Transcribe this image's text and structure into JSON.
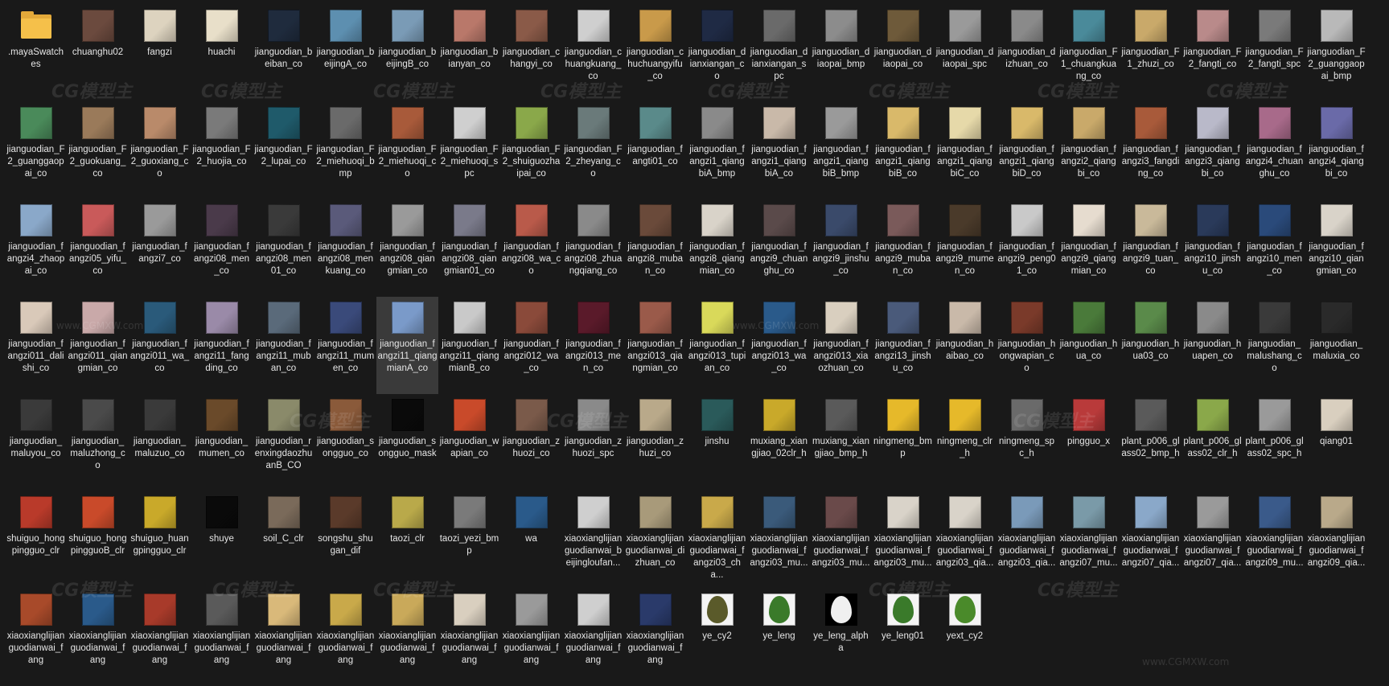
{
  "files": [
    {
      "name": ".mayaSwatches",
      "type": "folder"
    },
    {
      "name": "chuanghu02",
      "color": "#6b4a3e"
    },
    {
      "name": "fangzi",
      "color": "#ddd3bf"
    },
    {
      "name": "huachi",
      "color": "#e8dfc9"
    },
    {
      "name": "jianguodian_beiban_co",
      "color": "#1f2b3d"
    },
    {
      "name": "jianguodian_beijingA_co",
      "color": "#5d8fb0"
    },
    {
      "name": "jianguodian_beijingB_co",
      "color": "#7a9bb6"
    },
    {
      "name": "jianguodian_bianyan_co",
      "color": "#b9786a"
    },
    {
      "name": "jianguodian_changyi_co",
      "color": "#8a5a48"
    },
    {
      "name": "jianguodian_chuangkuang_co",
      "color": "#cfcfcf"
    },
    {
      "name": "jianguodian_chuchuangyifu_co",
      "color": "#c99a4a"
    },
    {
      "name": "jianguodian_dianxiangan_co",
      "color": "#1f2a44"
    },
    {
      "name": "jianguodian_dianxiangan_spc",
      "color": "#6a6a6a"
    },
    {
      "name": "jianguodian_diaopai_bmp",
      "color": "#8c8c8c"
    },
    {
      "name": "jianguodian_diaopai_co",
      "color": "#6e5a3a"
    },
    {
      "name": "jianguodian_diaopai_spc",
      "color": "#9a9a9a"
    },
    {
      "name": "jianguodian_dizhuan_co",
      "color": "#8a8a8a"
    },
    {
      "name": "jianguodian_F1_chuangkuang_co",
      "color": "#4a8a9a"
    },
    {
      "name": "jianguodian_F1_zhuzi_co",
      "color": "#c9a96a"
    },
    {
      "name": "jianguodian_F2_fangti_co",
      "color": "#b98a8a"
    },
    {
      "name": "jianguodian_F2_fangti_spc",
      "color": "#7a7a7a"
    },
    {
      "name": "jianguodian_F2_guanggaopai_bmp",
      "color": "#b9b9b9"
    },
    {
      "name": "jianguodian_F2_guanggaopai_co",
      "color": "#4a8a5a"
    },
    {
      "name": "jianguodian_F2_guokuang_co",
      "color": "#9a7a5a"
    },
    {
      "name": "jianguodian_F2_guoxiang_co",
      "color": "#b98a6a"
    },
    {
      "name": "jianguodian_F2_huojia_co",
      "color": "#7a7a7a"
    },
    {
      "name": "jianguodian_F2_lupai_co",
      "color": "#1f5a6a"
    },
    {
      "name": "jianguodian_F2_miehuoqi_bmp",
      "color": "#6a6a6a"
    },
    {
      "name": "jianguodian_F2_miehuoqi_co",
      "color": "#a85a3a"
    },
    {
      "name": "jianguodian_F2_miehuoqi_spc",
      "color": "#cfcfcf"
    },
    {
      "name": "jianguodian_F2_shuiguozhaipai_co",
      "color": "#8aa84a"
    },
    {
      "name": "jianguodian_F2_zheyang_co",
      "color": "#6a7a7a"
    },
    {
      "name": "jianguodian_fangti01_co",
      "color": "#5a8a8a"
    },
    {
      "name": "jianguodian_fangzi1_qiangbiA_bmp",
      "color": "#8a8a8a"
    },
    {
      "name": "jianguodian_fangzi1_qiangbiA_co",
      "color": "#c9b9a9"
    },
    {
      "name": "jianguodian_fangzi1_qiangbiB_bmp",
      "color": "#9a9a9a"
    },
    {
      "name": "jianguodian_fangzi1_qiangbiB_co",
      "color": "#d9b96a"
    },
    {
      "name": "jianguodian_fangzi1_qiangbiC_co",
      "color": "#e6d9a9"
    },
    {
      "name": "jianguodian_fangzi1_qiangbiD_co",
      "color": "#d9b96a"
    },
    {
      "name": "jianguodian_fangzi2_qiangbi_co",
      "color": "#c9a96a"
    },
    {
      "name": "jianguodian_fangzi3_fangding_co",
      "color": "#a85a3a"
    },
    {
      "name": "jianguodian_fangzi3_qiangbi_co",
      "color": "#b9b9c9"
    },
    {
      "name": "jianguodian_fangzi4_chuanghu_co",
      "color": "#a86a8a"
    },
    {
      "name": "jianguodian_fangzi4_qiangbi_co",
      "color": "#6a6aa8"
    },
    {
      "name": "jianguodian_fangzi4_zhaopai_co",
      "color": "#8aa8c9"
    },
    {
      "name": "jianguodian_fangzi05_yifu_co",
      "color": "#c95a5a"
    },
    {
      "name": "jianguodian_fangzi7_co",
      "color": "#9a9a9a"
    },
    {
      "name": "jianguodian_fangzi08_men_co",
      "color": "#4a3a4a"
    },
    {
      "name": "jianguodian_fangzi08_men01_co",
      "color": "#3a3a3a"
    },
    {
      "name": "jianguodian_fangzi08_menkuang_co",
      "color": "#5a5a7a"
    },
    {
      "name": "jianguodian_fangzi08_qiangmian_co",
      "color": "#9a9a9a"
    },
    {
      "name": "jianguodian_fangzi08_qiangmian01_co",
      "color": "#7a7a8a"
    },
    {
      "name": "jianguodian_fangzi08_wa_co",
      "color": "#b95a4a"
    },
    {
      "name": "jianguodian_fangzi08_zhuangqiang_co",
      "color": "#8a8a8a"
    },
    {
      "name": "jianguodian_fangzi8_muban_co",
      "color": "#6a4a3a"
    },
    {
      "name": "jianguodian_fangzi8_qiangmian_co",
      "color": "#d9d3c9"
    },
    {
      "name": "jianguodian_fangzi9_chuanghu_co",
      "color": "#5a4a4a"
    },
    {
      "name": "jianguodian_fangzi9_jinshu_co",
      "color": "#3a4a6a"
    },
    {
      "name": "jianguodian_fangzi9_muban_co",
      "color": "#7a5a5a"
    },
    {
      "name": "jianguodian_fangzi9_mumen_co",
      "color": "#4a3a2a"
    },
    {
      "name": "jianguodian_fangzi9_peng01_co",
      "color": "#c9c9c9"
    },
    {
      "name": "jianguodian_fangzi9_qiangmian_co",
      "color": "#e6dccf"
    },
    {
      "name": "jianguodian_fangzi9_tuan_co",
      "color": "#c9b99a"
    },
    {
      "name": "jianguodian_fangzi10_jinshu_co",
      "color": "#2a3a5a"
    },
    {
      "name": "jianguodian_fangzi10_men_co",
      "color": "#2a4a7a"
    },
    {
      "name": "jianguodian_fangzi10_qiangmian_co",
      "color": "#d9d3c9"
    },
    {
      "name": "jianguodian_fangzi011_dalishi_co",
      "color": "#d9c9b9"
    },
    {
      "name": "jianguodian_fangzi011_qiangmian_co",
      "color": "#c9a9a9"
    },
    {
      "name": "jianguodian_fangzi011_wa_co",
      "color": "#2a5a7a"
    },
    {
      "name": "jianguodian_fangzi11_fangding_co",
      "color": "#9a8aa8"
    },
    {
      "name": "jianguodian_fangzi11_muban_co",
      "color": "#5a6a7a"
    },
    {
      "name": "jianguodian_fangzi11_mumen_co",
      "color": "#3a4a7a"
    },
    {
      "name": "jianguodian_fangzi11_qiangmianA_co",
      "color": "#7a9ac9",
      "selected": true
    },
    {
      "name": "jianguodian_fangzi11_qiangmianB_co",
      "color": "#c9c9c9"
    },
    {
      "name": "jianguodian_fangzi012_wa_co",
      "color": "#8a4a3a"
    },
    {
      "name": "jianguodian_fangzi013_men_co",
      "color": "#5a1a2a"
    },
    {
      "name": "jianguodian_fangzi013_qiangmian_co",
      "color": "#9a5a4a"
    },
    {
      "name": "jianguodian_fangzi013_tupian_co",
      "color": "#d9d95a"
    },
    {
      "name": "jianguodian_fangzi013_wa_co",
      "color": "#2a5a8a"
    },
    {
      "name": "jianguodian_fangzi013_xiaozhuan_co",
      "color": "#d9cfbf"
    },
    {
      "name": "jianguodian_fangzi13_jinshu_co",
      "color": "#4a5a7a"
    },
    {
      "name": "jianguodian_haibao_co",
      "color": "#c9b9a9"
    },
    {
      "name": "jianguodian_hongwapian_co",
      "color": "#7a3a2a"
    },
    {
      "name": "jianguodian_hua_co",
      "color": "#4a7a3a"
    },
    {
      "name": "jianguodian_hua03_co",
      "color": "#5a8a4a"
    },
    {
      "name": "jianguodian_huapen_co",
      "color": "#8a8a8a"
    },
    {
      "name": "jianguodian_malushang_co",
      "color": "#3a3a3a"
    },
    {
      "name": "jianguodian_maluxia_co",
      "color": "#2a2a2a"
    },
    {
      "name": "jianguodian_maluyou_co",
      "color": "#3a3a3a"
    },
    {
      "name": "jianguodian_maluzhong_co",
      "color": "#4a4a4a"
    },
    {
      "name": "jianguodian_maluzuo_co",
      "color": "#3a3a3a"
    },
    {
      "name": "jianguodian_mumen_co",
      "color": "#6a4a2a"
    },
    {
      "name": "jianguodian_renxingdaozhuanB_CO",
      "color": "#8a8a6a"
    },
    {
      "name": "jianguodian_songguo_co",
      "color": "#8a5a3a"
    },
    {
      "name": "jianguodian_songguo_mask",
      "color": "#0a0a0a"
    },
    {
      "name": "jianguodian_wapian_co",
      "color": "#c94a2a"
    },
    {
      "name": "jianguodian_zhuozi_co",
      "color": "#7a5a4a"
    },
    {
      "name": "jianguodian_zhuozi_spc",
      "color": "#8a8a8a"
    },
    {
      "name": "jianguodian_zhuzi_co",
      "color": "#b9a98a"
    },
    {
      "name": "jinshu",
      "color": "#2a5a5a"
    },
    {
      "name": "muxiang_xiangjiao_02clr_h",
      "color": "#c9a92a"
    },
    {
      "name": "muxiang_xiangjiao_bmp_h",
      "color": "#5a5a5a"
    },
    {
      "name": "ningmeng_bmp",
      "color": "#e6b92a"
    },
    {
      "name": "ningmeng_clr_h",
      "color": "#e6b92a"
    },
    {
      "name": "ningmeng_spc_h",
      "color": "#6a6a6a"
    },
    {
      "name": "pingguo_x",
      "color": "#b93a3a"
    },
    {
      "name": "plant_p006_glass02_bmp_h",
      "color": "#5a5a5a"
    },
    {
      "name": "plant_p006_glass02_clr_h",
      "color": "#8aa84a"
    },
    {
      "name": "plant_p006_glass02_spc_h",
      "color": "#9a9a9a"
    },
    {
      "name": "qiang01",
      "color": "#d9cfbf"
    },
    {
      "name": "shuiguo_hongpingguo_clr",
      "color": "#b93a2a"
    },
    {
      "name": "shuiguo_hongpingguoB_clr",
      "color": "#c94a2a"
    },
    {
      "name": "shuiguo_huangpingguo_clr",
      "color": "#c9a92a"
    },
    {
      "name": "shuye",
      "color": "#0a0a0a"
    },
    {
      "name": "soil_C_clr",
      "color": "#7a6a5a"
    },
    {
      "name": "songshu_shugan_dif",
      "color": "#5a3a2a"
    },
    {
      "name": "taozi_clr",
      "color": "#b9a94a"
    },
    {
      "name": "taozi_yezi_bmp",
      "color": "#7a7a7a"
    },
    {
      "name": "wa",
      "color": "#2a5a8a"
    },
    {
      "name": "xiaoxianglijianguodianwai_beijingloufan...",
      "color": "#cfcfcf"
    },
    {
      "name": "xiaoxianglijianguodianwai_dizhuan_co",
      "color": "#a89a7a"
    },
    {
      "name": "xiaoxianglijianguodianwai_fangzi03_cha...",
      "color": "#c9a94a"
    },
    {
      "name": "xiaoxianglijianguodianwai_fangzi03_mu...",
      "color": "#3a5a7a"
    },
    {
      "name": "xiaoxianglijianguodianwai_fangzi03_mu...",
      "color": "#6a4a4a"
    },
    {
      "name": "xiaoxianglijianguodianwai_fangzi03_mu...",
      "color": "#d9d3c9"
    },
    {
      "name": "xiaoxianglijianguodianwai_fangzi03_qia...",
      "color": "#d9d3c9"
    },
    {
      "name": "xiaoxianglijianguodianwai_fangzi03_qia...",
      "color": "#7a9ab9"
    },
    {
      "name": "xiaoxianglijianguodianwai_fangzi07_mu...",
      "color": "#7a9aa8"
    },
    {
      "name": "xiaoxianglijianguodianwai_fangzi07_qia...",
      "color": "#8aa8c9"
    },
    {
      "name": "xiaoxianglijianguodianwai_fangzi07_qia...",
      "color": "#9a9a9a"
    },
    {
      "name": "xiaoxianglijianguodianwai_fangzi09_mu...",
      "color": "#3a5a8a"
    },
    {
      "name": "xiaoxianglijianguodianwai_fangzi09_qia...",
      "color": "#b9a98a"
    },
    {
      "name": "xiaoxianglijianguodianwai_fang",
      "color": "#a84a2a"
    },
    {
      "name": "xiaoxianglijianguodianwai_fang",
      "color": "#2a5a8a"
    },
    {
      "name": "xiaoxianglijianguodianwai_fang",
      "color": "#a83a2a"
    },
    {
      "name": "xiaoxianglijianguodianwai_fang",
      "color": "#5a5a5a"
    },
    {
      "name": "xiaoxianglijianguodianwai_fang",
      "color": "#d9b97a"
    },
    {
      "name": "xiaoxianglijianguodianwai_fang",
      "color": "#c9a94a"
    },
    {
      "name": "xiaoxianglijianguodianwai_fang",
      "color": "#c9a95a"
    },
    {
      "name": "xiaoxianglijianguodianwai_fang",
      "color": "#d9cfbf"
    },
    {
      "name": "xiaoxianglijianguodianwai_fang",
      "color": "#9a9a9a"
    },
    {
      "name": "xiaoxianglijianguodianwai_fang",
      "color": "#cfcfcf"
    },
    {
      "name": "xiaoxianglijianguodianwai_fang",
      "color": "#2a3a6a"
    },
    {
      "name": "ye_cy2",
      "color": "#5a5a2a",
      "shape": "leaf"
    },
    {
      "name": "ye_leng",
      "color": "#3a7a2a",
      "shape": "leaf"
    },
    {
      "name": "ye_leng_alpha",
      "color": "#f0f0f0",
      "shape": "leaf-mask"
    },
    {
      "name": "ye_leng01",
      "color": "#3a7a2a",
      "shape": "leaf"
    },
    {
      "name": "yext_cy2",
      "color": "#4a8a2a",
      "shape": "leaf"
    }
  ],
  "watermark": {
    "brand": "CG模型主",
    "url": "www.CGMXW.com"
  }
}
